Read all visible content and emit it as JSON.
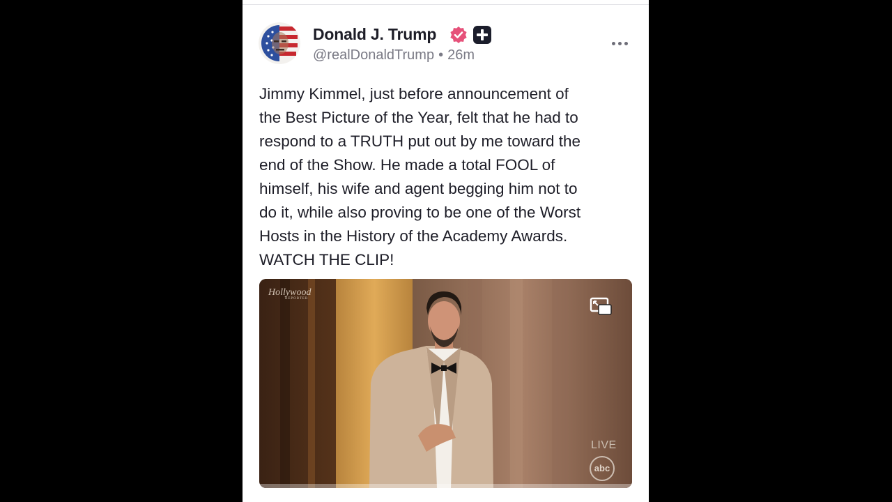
{
  "post": {
    "author": {
      "name": "Donald J. Trump",
      "handle": "@realDonaldTrump",
      "separator": "•",
      "time": "26m",
      "verified_badge_color": "#e6517a",
      "plus_badge_color": "#1b1d2b"
    },
    "more_icon": "more-horizontal-icon",
    "text_lines": [
      "Jimmy Kimmel, just before announcement of",
      "the Best Picture of the Year, felt that he had to",
      "respond to a TRUTH put out by me toward the",
      "end of the Show. He made a total FOOL of",
      "himself, his wife and agent begging him not to",
      "do it, while also proving to be one of the Worst",
      "Hosts in the History of the Academy Awards.",
      "WATCH THE CLIP!"
    ],
    "media": {
      "watermark": "Hollywood",
      "watermark_sub": "REPORTER",
      "live_label": "LIVE",
      "network_logo": "abc",
      "pip_icon": "picture-in-picture-icon",
      "progress": 0.0
    }
  }
}
